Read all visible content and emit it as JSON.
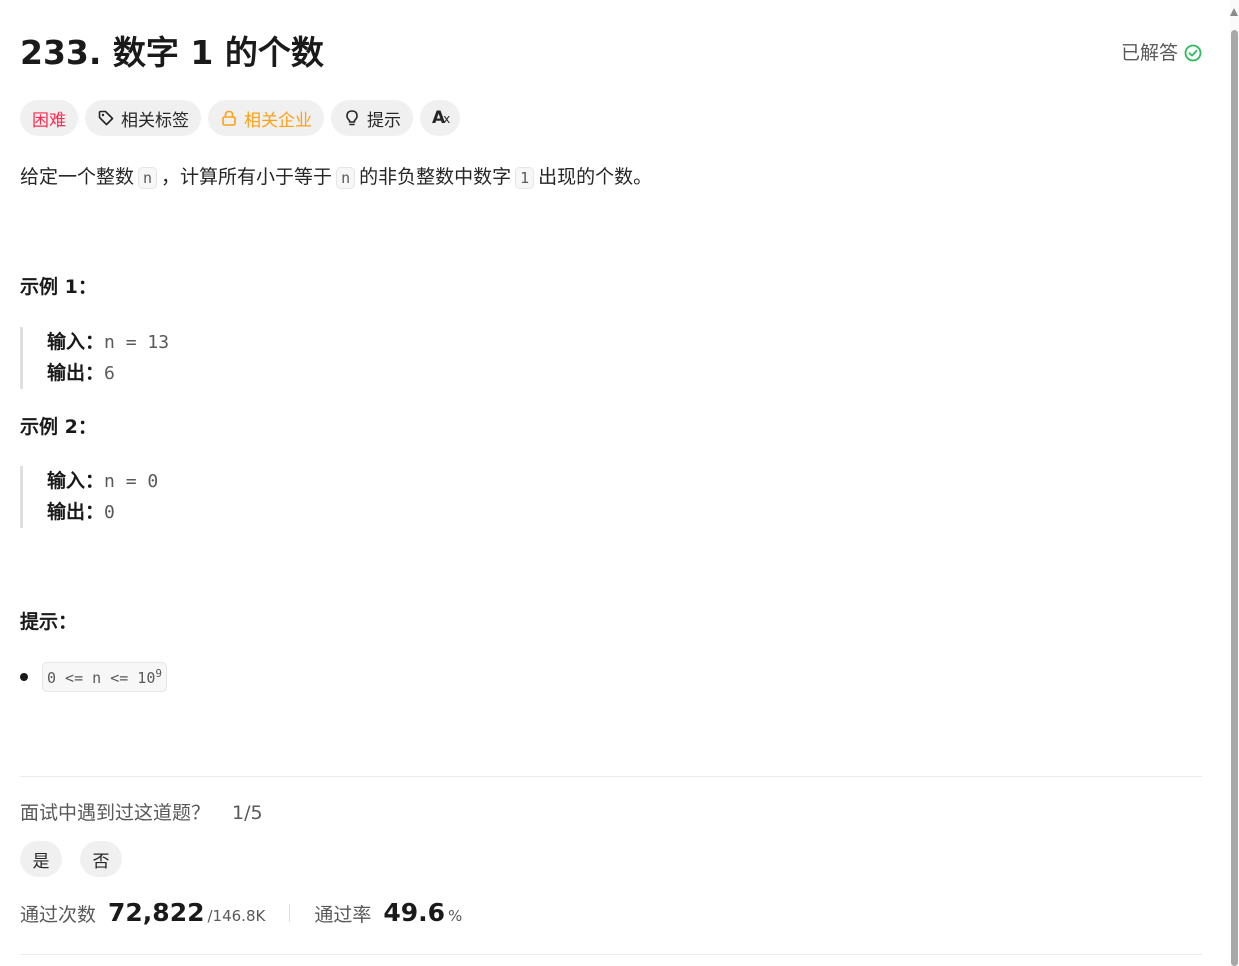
{
  "problem": {
    "title": "233. 数字 1 的个数",
    "solved_label": "已解答"
  },
  "tags": {
    "difficulty": "困难",
    "related_tags": "相关标签",
    "related_companies": "相关企业",
    "hint": "提示",
    "translate": "A",
    "translate_sub": "x"
  },
  "description": {
    "p1": "给定一个整数",
    "code_n": "n",
    "p2": "，计算所有小于等于",
    "p3": "的非负整数中数字",
    "code_1": "1",
    "p4": "出现的个数。"
  },
  "examples": [
    {
      "title": "示例 1：",
      "input_label": "输入：",
      "input_value": "n = 13",
      "output_label": "输出：",
      "output_value": "6"
    },
    {
      "title": "示例 2：",
      "input_label": "输入：",
      "input_value": "n = 0",
      "output_label": "输出：",
      "output_value": "0"
    }
  ],
  "constraints": {
    "title": "提示：",
    "item_base": "0 <= n <= 10",
    "item_exp": "9"
  },
  "interview": {
    "question": "面试中遇到过这道题？",
    "count": "1/5",
    "yes": "是",
    "no": "否"
  },
  "stats": {
    "accepted_label": "通过次数",
    "accepted_value": "72,822",
    "submissions": "/146.8K",
    "rate_label": "通过率",
    "rate_value": "49.6",
    "rate_unit": "%"
  },
  "colors": {
    "hard": "#ff2d55",
    "company": "#ffa116",
    "solved_check": "#2cbb5d"
  }
}
